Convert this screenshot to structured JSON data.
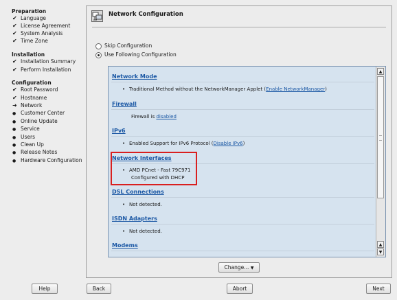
{
  "sidebar": {
    "sections": [
      {
        "title": "Preparation",
        "steps": [
          {
            "label": "Language",
            "state": "done"
          },
          {
            "label": "License Agreement",
            "state": "done"
          },
          {
            "label": "System Analysis",
            "state": "done"
          },
          {
            "label": "Time Zone",
            "state": "done"
          }
        ]
      },
      {
        "title": "Installation",
        "steps": [
          {
            "label": "Installation Summary",
            "state": "done"
          },
          {
            "label": "Perform Installation",
            "state": "done"
          }
        ]
      },
      {
        "title": "Configuration",
        "steps": [
          {
            "label": "Root Password",
            "state": "done"
          },
          {
            "label": "Hostname",
            "state": "done"
          },
          {
            "label": "Network",
            "state": "current"
          },
          {
            "label": "Customer Center",
            "state": "pending"
          },
          {
            "label": "Online Update",
            "state": "pending"
          },
          {
            "label": "Service",
            "state": "pending"
          },
          {
            "label": "Users",
            "state": "pending"
          },
          {
            "label": "Clean Up",
            "state": "pending"
          },
          {
            "label": "Release Notes",
            "state": "pending"
          },
          {
            "label": "Hardware Configuration",
            "state": "pending"
          }
        ]
      }
    ],
    "marks": {
      "done": "✔",
      "current": "➜",
      "pending": "●"
    }
  },
  "header": {
    "title": "Network Configuration",
    "icon": "network-config-icon"
  },
  "options": {
    "skip": {
      "label": "Skip Configuration",
      "selected": false
    },
    "use": {
      "label": "Use Following Configuration",
      "selected": true
    }
  },
  "summary": {
    "network_mode": {
      "heading": "Network Mode",
      "text": "Traditional Method without the NetworkManager Applet (",
      "link": "Enable NetworkManager",
      "tail": ")"
    },
    "firewall": {
      "heading": "Firewall",
      "text": "Firewall is ",
      "link": "disabled"
    },
    "ipv6": {
      "heading": "IPv6",
      "text": "Enabled Support for IPv6 Protocol (",
      "link": "Disable IPv6",
      "tail": ")"
    },
    "interfaces": {
      "heading": "Network Interfaces",
      "line1": "AMD PCnet - Fast 79C971",
      "line2": "Configured with DHCP"
    },
    "dsl": {
      "heading": "DSL Connections",
      "text": "Not detected."
    },
    "isdn": {
      "heading": "ISDN Adapters",
      "text": "Not detected."
    },
    "modems": {
      "heading": "Modems"
    }
  },
  "buttons": {
    "change": "Change...",
    "help": "Help",
    "back": "Back",
    "abort": "Abort",
    "next": "Next"
  },
  "colors": {
    "link": "#1a57a4",
    "highlight": "#d91f1f",
    "panel_bg": "#d6e3ef"
  }
}
